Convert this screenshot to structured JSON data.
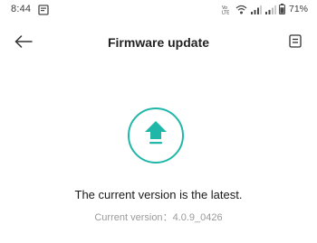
{
  "status_bar": {
    "time": "8:44",
    "battery_percent": "71%",
    "icons": [
      "notification-icon",
      "volte-icon",
      "wifi-icon",
      "signal-icon",
      "signal-icon",
      "battery-icon"
    ]
  },
  "header": {
    "title": "Firmware update",
    "back_icon": "arrow-left-icon",
    "log_icon": "document-icon"
  },
  "main": {
    "status_icon": "upload-arrow-icon",
    "message": "The current version is the latest.",
    "version_label": "Current version",
    "version_separator": "：",
    "version_value": "4.0.9_0426"
  },
  "colors": {
    "accent": "#20b7a8",
    "text_primary": "#1a1a1a",
    "text_secondary": "#9a9a9a"
  }
}
